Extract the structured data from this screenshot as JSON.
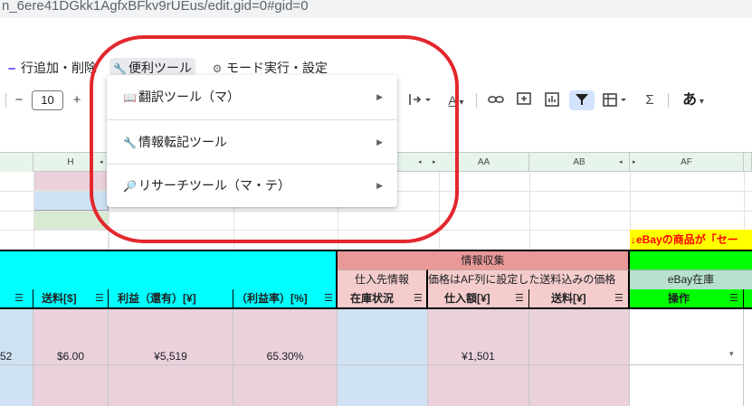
{
  "url": {
    "text": "n_6ere41DGkk1AgfxBFkv9rUEus/edit.gid=0#gid=0"
  },
  "menubar": {
    "row_edit": "行追加・削除",
    "tools": "便利ツール",
    "mode": "モード実行・設定"
  },
  "toolbar": {
    "minus": "−",
    "font_size": "10",
    "plus": "+",
    "text_a": "A",
    "sigma": "Σ",
    "ime": "あ"
  },
  "dropdown": {
    "items": [
      {
        "label": "翻訳ツール（マ）",
        "icon": "book-icon"
      },
      {
        "label": "情報転記ツール",
        "icon": "wrench-icon"
      },
      {
        "label": "リサーチツール（マ・テ）",
        "icon": "magnifier-icon"
      }
    ]
  },
  "columns": {
    "h": "H",
    "aa": "AA",
    "ab": "AB",
    "af": "AF"
  },
  "banner": {
    "af_note": "↓eBayの商品が「セー"
  },
  "header": {
    "info_collect": "情報収集",
    "supplier_info": "仕入先情報",
    "price_note": "価格はAF列に設定した送料込みの価格",
    "ebay_stock": "eBay在庫",
    "shipping_usd": "送料[$]",
    "profit": "利益（還有）[¥]",
    "profit_rate": "（利益率）[%]",
    "stock_status": "在庫状況",
    "purchase_price": "仕入額[¥]",
    "shipping_jpy": "送料[¥]",
    "operation": "操作"
  },
  "rows": [
    {
      "partial": "52",
      "shipping_usd": "$6.00",
      "profit": "¥5,519",
      "profit_rate": "65.30%",
      "purchase_price": "¥1,501"
    }
  ],
  "colors": {
    "cyan": "#00ffff",
    "pink": "#ead1dc",
    "salmon": "#ea9999",
    "light_salmon": "#f4cccc",
    "green": "#00ff00",
    "light_green": "#b7e1cd",
    "blue_light": "#cfe2f3",
    "yellow": "#ffff00",
    "red": "#e3272d"
  }
}
